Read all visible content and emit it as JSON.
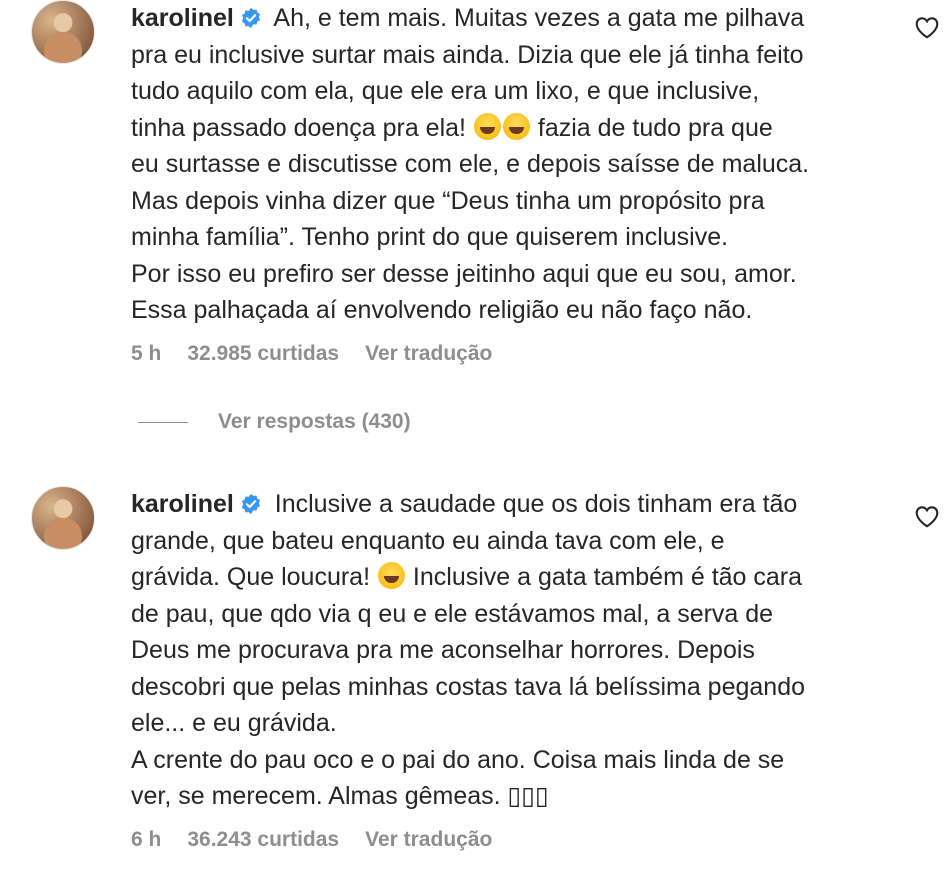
{
  "comments": [
    {
      "username": "karolinel",
      "text_line1": " Ah, e tem mais. Muitas vezes a gata me pilhava",
      "text_lines_a": "pra eu inclusive surtar mais ainda. Dizia que ele já tinha feito\ntudo aquilo com ela, que ele era um lixo, e que inclusive,\ntinha passado doença pra ela! ",
      "text_lines_b": " fazia de tudo pra que\neu surtasse e discutisse com ele, e depois saísse de maluca.\nMas depois vinha dizer que “Deus tinha um propósito pra\nminha família”. Tenho print do que quiserem inclusive.\nPor isso eu prefiro ser desse jeitinho aqui que eu sou, amor.\nEssa palhaçada aí envolvendo religião eu não faço não.",
      "time": "5 h",
      "likes": "32.985 curtidas",
      "translate": "Ver tradução"
    },
    {
      "username": "karolinel",
      "text_line1": " Inclusive a saudade que os dois tinham era tão",
      "text_lines_a": "grande, que bateu enquanto eu ainda tava com ele, e\ngrávida. Que loucura! ",
      "text_lines_b": " Inclusive a gata também é tão cara\nde pau, que qdo via q eu e ele estávamos mal, a serva de\nDeus me procurava pra me aconselhar horrores. Depois\ndescobri que pelas minhas costas tava lá belíssima pegando\nele... e eu grávida.\nA crente do pau oco e o pai do ano. Coisa mais linda de se\nver, se merecem. Almas gêmeas. ▯▯▯",
      "time": "6 h",
      "likes": "36.243 curtidas",
      "translate": "Ver tradução"
    }
  ],
  "replies_label": "Ver respostas (430)",
  "icons": {
    "verified": "verified-badge-icon",
    "like": "heart-icon",
    "emoji": "laughing-emoji"
  },
  "colors": {
    "text": "#262626",
    "muted": "#8e8e8e",
    "verified": "#3897f0"
  }
}
